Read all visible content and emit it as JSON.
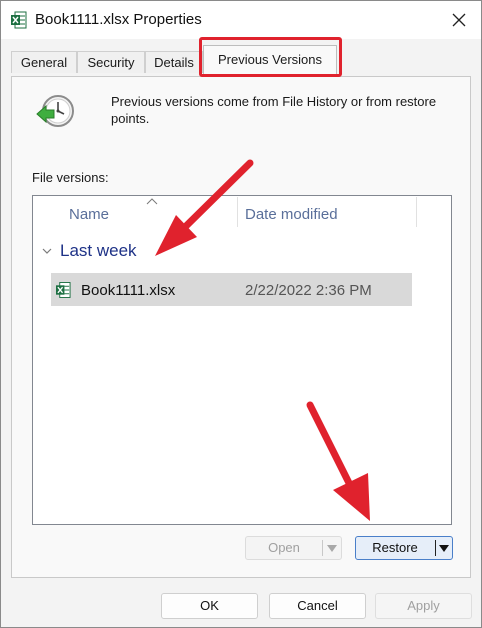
{
  "window": {
    "title": "Book1111.xlsx Properties"
  },
  "tabs": [
    {
      "label": "General"
    },
    {
      "label": "Security"
    },
    {
      "label": "Details"
    },
    {
      "label": "Previous Versions",
      "active": true
    }
  ],
  "panel": {
    "description": "Previous versions come from File History or from restore points.",
    "file_versions_label": "File versions:",
    "columns": {
      "name": "Name",
      "date_modified": "Date modified"
    },
    "group": {
      "title": "Last week"
    },
    "rows": [
      {
        "name": "Book1111.xlsx",
        "date_modified": "2/22/2022 2:36 PM",
        "selected": true
      }
    ],
    "open_button": "Open",
    "restore_button": "Restore"
  },
  "footer": {
    "ok": "OK",
    "cancel": "Cancel",
    "apply": "Apply"
  },
  "icons": {
    "title": "excel-file-icon",
    "close": "close-icon",
    "history": "clock-restore-icon",
    "row": "excel-file-icon",
    "dropdown": "chevron-down-icon"
  },
  "colors": {
    "annotation_red": "#e0222d",
    "accent_blue": "#4a7fc9",
    "group_title": "#1e3287",
    "excel_green": "#1d6f42"
  }
}
